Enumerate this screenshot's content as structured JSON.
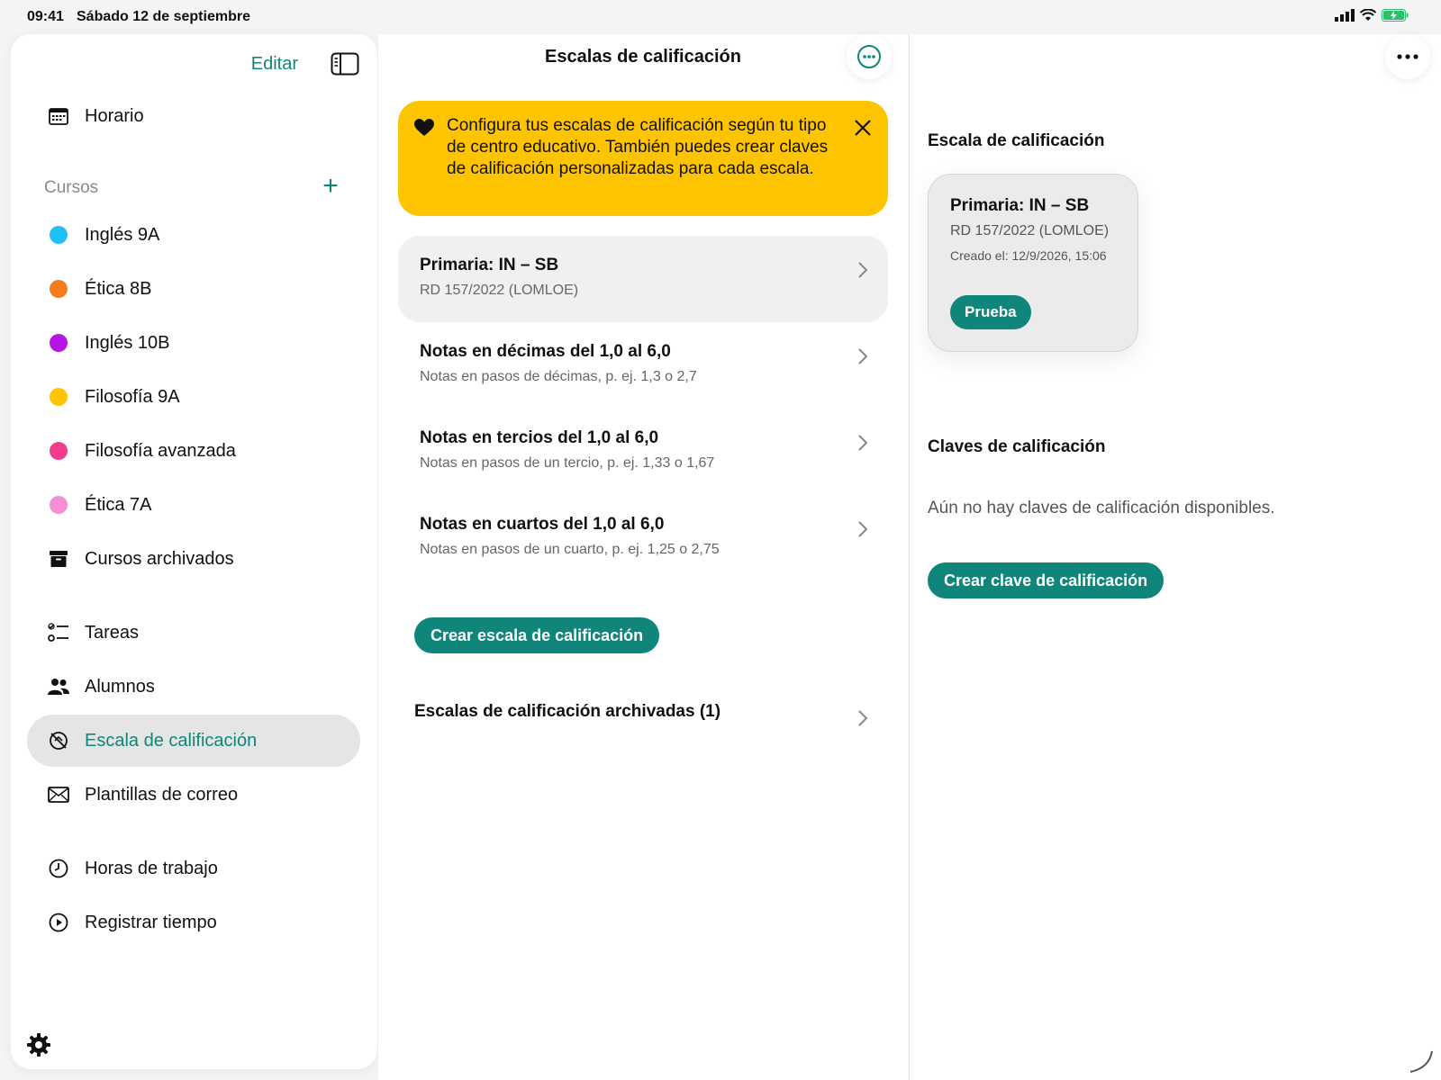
{
  "status_bar": {
    "time": "09:41",
    "date": "Sábado 12 de septiembre"
  },
  "sidebar": {
    "edit_label": "Editar",
    "schedule_label": "Horario",
    "courses_heading": "Cursos",
    "courses": [
      {
        "label": "Inglés 9A",
        "color": "#1ec0f5"
      },
      {
        "label": "Ética 8B",
        "color": "#f57c1e"
      },
      {
        "label": "Inglés 10B",
        "color": "#b514e3"
      },
      {
        "label": "Filosofía 9A",
        "color": "#ffc400"
      },
      {
        "label": "Filosofía avanzada",
        "color": "#f23d8e"
      },
      {
        "label": "Ética 7A",
        "color": "#f78ed4"
      }
    ],
    "archived_courses_label": "Cursos archivados",
    "tasks_label": "Tareas",
    "students_label": "Alumnos",
    "grading_scale_label": "Escala de calificación",
    "email_templates_label": "Plantillas de correo",
    "work_hours_label": "Horas de trabajo",
    "track_time_label": "Registrar tiempo"
  },
  "middle": {
    "title": "Escalas de calificación",
    "banner_text": "Configura tus escalas de calificación según tu tipo de centro educativo. También puedes crear claves de calificación personalizadas para cada escala.",
    "scales": [
      {
        "title": "Primaria: IN – SB",
        "subtitle": "RD 157/2022 (LOMLOE)"
      },
      {
        "title": "Notas en décimas del 1,0 al 6,0",
        "subtitle": "Notas en pasos de décimas, p. ej. 1,3 o 2,7"
      },
      {
        "title": "Notas en tercios del 1,0 al 6,0",
        "subtitle": "Notas en pasos de un tercio, p. ej. 1,33 o 1,67"
      },
      {
        "title": "Notas en cuartos del 1,0 al 6,0",
        "subtitle": "Notas en pasos de un cuarto, p. ej. 1,25 o 2,75"
      }
    ],
    "create_scale_label": "Crear escala de calificación",
    "archived_scales_label": "Escalas de calificación archivadas (1)"
  },
  "right": {
    "scale_section_title": "Escala de calificación",
    "card": {
      "title": "Primaria: IN – SB",
      "subtitle": "RD 157/2022 (LOMLOE)",
      "created": "Creado el: 12/9/2026, 15:06",
      "test_label": "Prueba"
    },
    "keys_section_title": "Claves de calificación",
    "empty_text": "Aún no hay claves de calificación disponibles.",
    "create_key_label": "Crear clave de calificación"
  },
  "colors": {
    "accent": "#10857a",
    "banner": "#ffc400"
  }
}
